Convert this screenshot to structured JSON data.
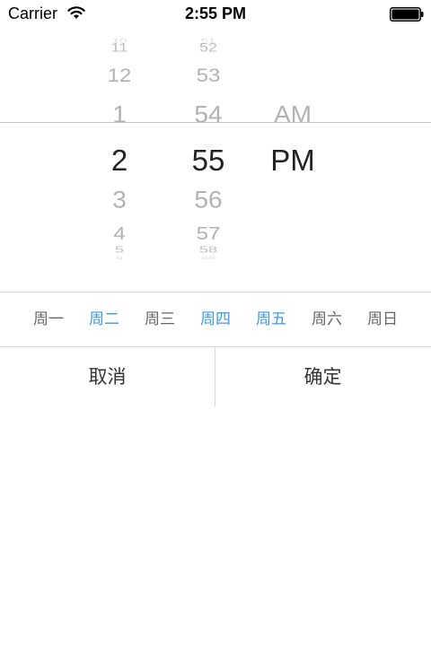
{
  "status_bar": {
    "carrier": "Carrier",
    "time": "2:55 PM"
  },
  "picker": {
    "hours": [
      "10",
      "11",
      "12",
      "1",
      "2",
      "3",
      "4",
      "5",
      "6"
    ],
    "minutes": [
      "51",
      "52",
      "53",
      "54",
      "55",
      "56",
      "57",
      "58",
      "59"
    ],
    "periods": [
      "AM",
      "PM"
    ],
    "selected": {
      "hour": "2",
      "minute": "55",
      "period": "PM"
    }
  },
  "weekdays": [
    {
      "label": "周一",
      "selected": false
    },
    {
      "label": "周二",
      "selected": true
    },
    {
      "label": "周三",
      "selected": false
    },
    {
      "label": "周四",
      "selected": true
    },
    {
      "label": "周五",
      "selected": true
    },
    {
      "label": "周六",
      "selected": false
    },
    {
      "label": "周日",
      "selected": false
    }
  ],
  "actions": {
    "cancel_label": "取消",
    "confirm_label": "确定"
  },
  "colors": {
    "selected_day": "#3d9ae8",
    "unselected_day": "#666666",
    "picker_selected": "#222222",
    "picker_faded": "#b2b2b2",
    "separator": "#d6d6d6"
  },
  "icons": {
    "wifi": "wifi-icon",
    "battery": "battery-icon"
  }
}
